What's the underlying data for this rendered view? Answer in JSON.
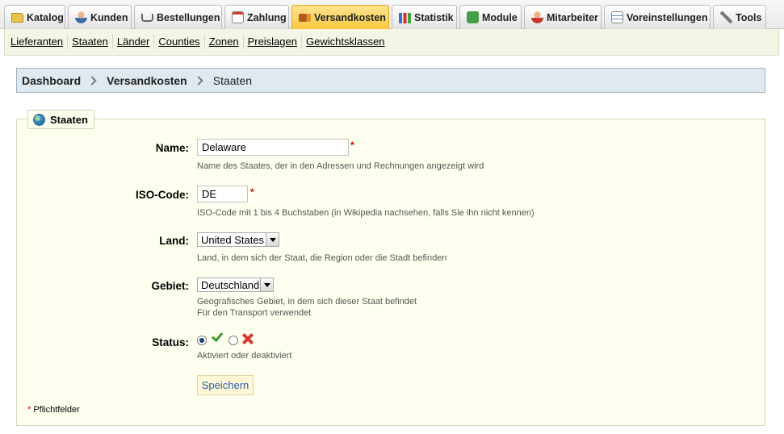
{
  "tabs": [
    {
      "label": "Katalog",
      "icon": "folder-icon"
    },
    {
      "label": "Kunden",
      "icon": "user-icon"
    },
    {
      "label": "Bestellungen",
      "icon": "cart-icon"
    },
    {
      "label": "Zahlung",
      "icon": "calculator-icon"
    },
    {
      "label": "Versandkosten",
      "icon": "truck-icon",
      "active": true
    },
    {
      "label": "Statistik",
      "icon": "bar-chart-icon"
    },
    {
      "label": "Module",
      "icon": "puzzle-icon"
    },
    {
      "label": "Mitarbeiter",
      "icon": "employee-icon"
    },
    {
      "label": "Voreinstellungen",
      "icon": "form-icon"
    },
    {
      "label": "Tools",
      "icon": "wrench-icon"
    }
  ],
  "subnav": [
    "Lieferanten",
    "Staaten",
    "Länder",
    "Counties",
    "Zonen",
    "Preislagen",
    "Gewichtsklassen"
  ],
  "breadcrumb": {
    "items": [
      "Dashboard",
      "Versandkosten",
      "Staaten"
    ]
  },
  "panel": {
    "title": "Staaten",
    "icon": "globe-icon"
  },
  "form": {
    "name": {
      "label": "Name:",
      "value": "Delaware",
      "required": "*",
      "hint": "Name des Staates, der in den Adressen und Rechnungen angezeigt wird"
    },
    "iso": {
      "label": "ISO-Code:",
      "value": "DE",
      "required": "*",
      "hint": "ISO-Code mit 1 bis 4 Buchstaben (in Wikipedia nachsehen, falls Sie ihn nicht kennen)"
    },
    "land": {
      "label": "Land:",
      "selected": "United States",
      "hint": "Land, in dem sich der Staat, die Region oder die Stadt befinden"
    },
    "gebiet": {
      "label": "Gebiet:",
      "selected": "Deutschland",
      "hint_line1": "Geografisches Gebiet, in dem sich dieser Staat befindet",
      "hint_line2": "Für den Transport verwendet"
    },
    "status": {
      "label": "Status:",
      "selected": "enabled",
      "hint": "Aktiviert oder deaktiviert"
    }
  },
  "save_label": "Speichern",
  "footnote": {
    "star": "*",
    "text": "Pflichtfelder"
  },
  "colors": {
    "active_tab": "#f9c93c",
    "panel_bg": "#fffff0",
    "breadcrumb_bg": "#dfe9ef",
    "required": "#dd0000",
    "link": "#2b5fb0"
  }
}
